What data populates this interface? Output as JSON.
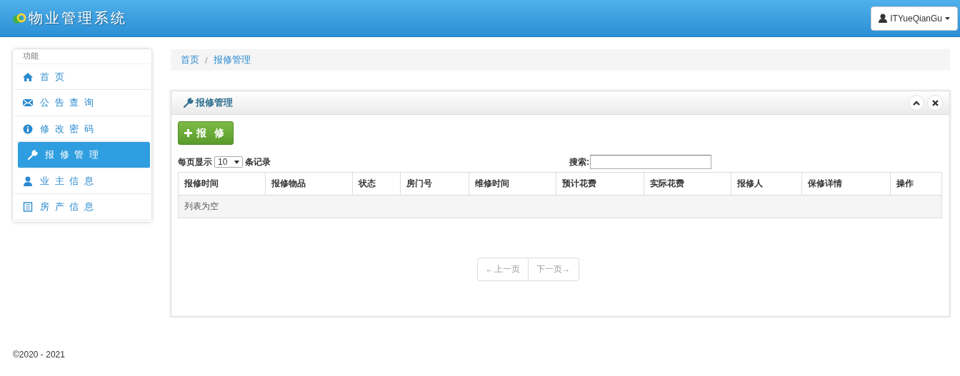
{
  "header": {
    "title": "物业管理系统",
    "user": "ITYueQianGu"
  },
  "sidebar": {
    "heading": "功能",
    "items": [
      {
        "label": "首 页",
        "kind": "home",
        "selected": false
      },
      {
        "label": "公 告 查 询",
        "kind": "mail",
        "selected": false
      },
      {
        "label": "修 改 密 码",
        "kind": "info",
        "selected": false
      },
      {
        "label": "报 修 管 理",
        "kind": "wrench",
        "selected": true
      },
      {
        "label": "业 主 信 息",
        "kind": "user",
        "selected": false
      },
      {
        "label": "房 产 信 息",
        "kind": "list",
        "selected": false
      }
    ]
  },
  "breadcrumb": [
    "首页",
    "报修管理"
  ],
  "breadcrumb_separator": "/",
  "panel": {
    "title": "报修管理",
    "add_button": "报 修",
    "page_size_prefix": "每页显示",
    "page_size": "10",
    "page_size_suffix": "条记录",
    "search_label": "搜索:",
    "table": {
      "columns": [
        "报修时间",
        "报修物品",
        "状态",
        "房门号",
        "维修时间",
        "预计花费",
        "实际花费",
        "报修人",
        "保修详情",
        "操作"
      ],
      "empty": "列表为空"
    },
    "pager": [
      {
        "label": "←上一页",
        "disabled": true
      },
      {
        "label": "下一页→",
        "disabled": true
      }
    ]
  },
  "footer": "©2020 - 2021"
}
